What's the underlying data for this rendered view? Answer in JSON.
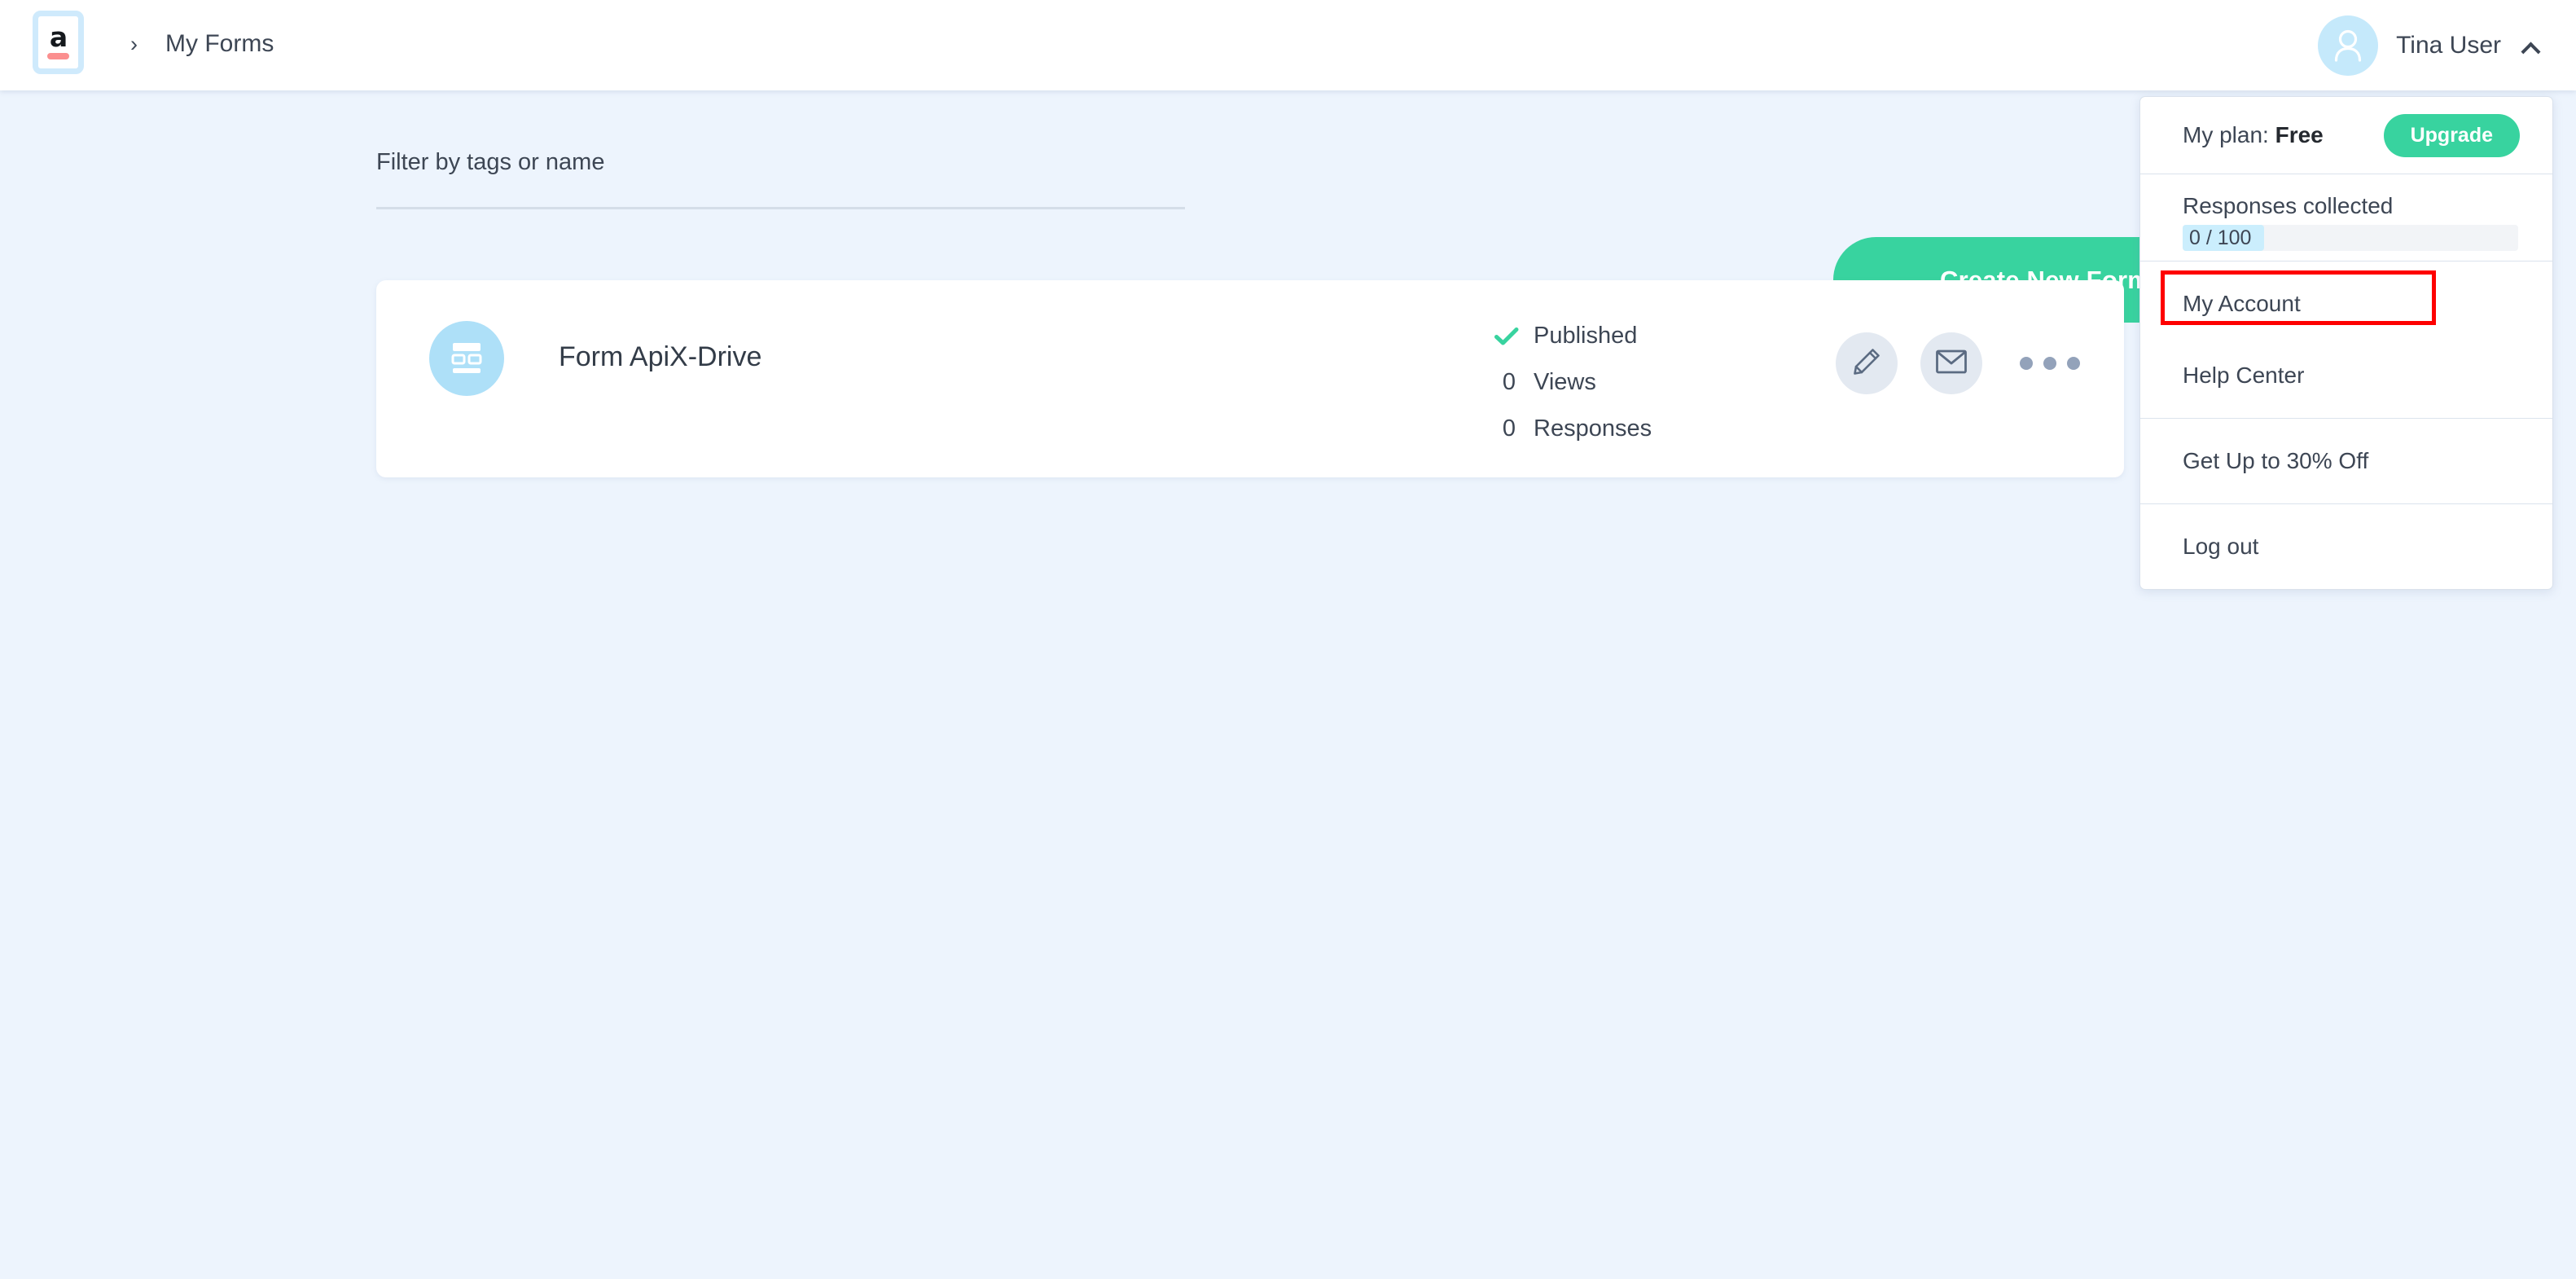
{
  "header": {
    "logo": {
      "letter": "a",
      "icon": "apix-logo-icon"
    },
    "breadcrumb_separator": "›",
    "breadcrumb_title": "My Forms",
    "user_name": "Tina User",
    "avatar_icon": "user-avatar-icon",
    "caret_icon": "chevron-up-icon"
  },
  "toolbar": {
    "filter_label": "Filter by tags or name",
    "filter_value": "",
    "filter_chevron_icon": "chevron-down-icon",
    "create_label": "Create New Form"
  },
  "form_card": {
    "icon": "form-layout-icon",
    "title": "Form ApiX-Drive",
    "stats": [
      {
        "value": "",
        "label": "Published",
        "icon": "check-icon"
      },
      {
        "value": "0",
        "label": "Views",
        "icon": ""
      },
      {
        "value": "0",
        "label": "Responses",
        "icon": ""
      }
    ],
    "actions": [
      {
        "name": "edit-form-button",
        "icon": "pencil-icon"
      },
      {
        "name": "share-email-button",
        "icon": "envelope-icon"
      },
      {
        "name": "more-options-button",
        "icon": "ellipsis-icon"
      }
    ]
  },
  "dropdown": {
    "plan_prefix": "My plan: ",
    "plan_name": "Free",
    "upgrade_label": "Upgrade",
    "responses_label": "Responses collected",
    "responses_progress_text": "0 / 100",
    "responses_collected": 0,
    "responses_limit": 100,
    "items": [
      {
        "label": "My Account",
        "highlighted": true
      },
      {
        "label": "Help Center",
        "highlighted": false
      },
      {
        "label": "Get Up to 30% Off",
        "highlighted": false
      },
      {
        "label": "Log out",
        "highlighted": false
      }
    ]
  },
  "colors": {
    "accent_green": "#38d39f",
    "page_background": "#edf4fd",
    "avatar_blue": "#c5e9fb",
    "form_icon_blue": "#aee0f8",
    "progress_fill": "#cbeefd",
    "highlight_red": "#fe0000",
    "logo_bar": "#fb8f8f",
    "text_primary": "#3d4654"
  }
}
